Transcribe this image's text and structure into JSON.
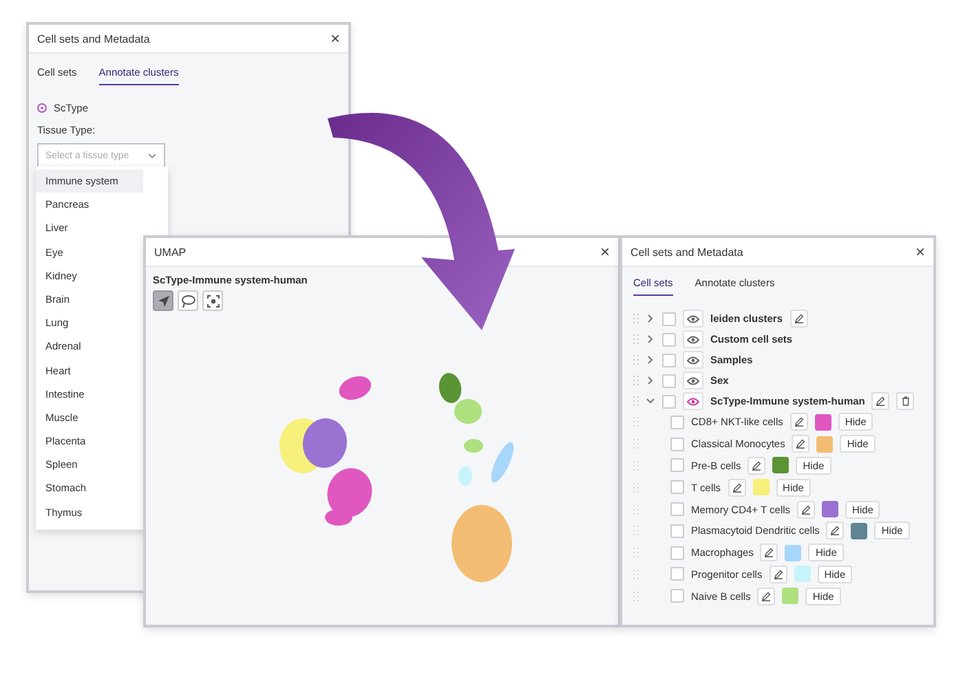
{
  "annotate_window": {
    "title": "Cell sets and Metadata",
    "close": "×",
    "tabs": [
      {
        "label": "Cell sets",
        "selected": false
      },
      {
        "label": "Annotate clusters",
        "selected": true
      }
    ],
    "method": {
      "label": "ScType",
      "selected": true
    },
    "tissue_label": "Tissue Type:",
    "tissue_select": {
      "placeholder": "Select a tissue type"
    },
    "tissue_options": [
      {
        "label": "Immune system",
        "selected": true
      },
      {
        "label": "Pancreas",
        "selected": false
      },
      {
        "label": "Liver",
        "selected": false
      },
      {
        "label": "Eye",
        "selected": false
      },
      {
        "label": "Kidney",
        "selected": false
      },
      {
        "label": "Brain",
        "selected": false
      },
      {
        "label": "Lung",
        "selected": false
      },
      {
        "label": "Adrenal",
        "selected": false
      },
      {
        "label": "Heart",
        "selected": false
      },
      {
        "label": "Intestine",
        "selected": false
      },
      {
        "label": "Muscle",
        "selected": false
      },
      {
        "label": "Placenta",
        "selected": false
      },
      {
        "label": "Spleen",
        "selected": false
      },
      {
        "label": "Stomach",
        "selected": false
      },
      {
        "label": "Thymus",
        "selected": false
      }
    ]
  },
  "umap_window": {
    "title": "UMAP",
    "close": "×",
    "plot_title": "ScType-Immune system-human",
    "tools": [
      {
        "kind": "select",
        "selected": true
      },
      {
        "kind": "lasso",
        "selected": false
      },
      {
        "kind": "focus",
        "selected": false
      }
    ]
  },
  "cell_sets_window": {
    "title": "Cell sets and Metadata",
    "close": "×",
    "tabs": [
      {
        "label": "Cell sets",
        "selected": true
      },
      {
        "label": "Annotate clusters",
        "selected": false
      }
    ],
    "groups": [
      {
        "name": "leiden clusters",
        "expanded": false,
        "checked": false,
        "highlighted": false,
        "editable": true,
        "deletable": false
      },
      {
        "name": "Custom cell sets",
        "expanded": false,
        "checked": false,
        "highlighted": false,
        "editable": false,
        "deletable": false
      },
      {
        "name": "Samples",
        "expanded": false,
        "checked": false,
        "highlighted": false,
        "editable": false,
        "deletable": false
      },
      {
        "name": "Sex",
        "expanded": false,
        "checked": false,
        "highlighted": false,
        "editable": false,
        "deletable": false
      },
      {
        "name": "ScType-Immune system-human",
        "expanded": true,
        "checked": false,
        "highlighted": true,
        "editable": true,
        "deletable": true,
        "children": [
          {
            "name": "CD8+ NKT-like cells",
            "checked": false,
            "color": "#e057c0",
            "button": "Hide"
          },
          {
            "name": "Classical Monocytes",
            "checked": false,
            "color": "#f2bd72",
            "button": "Hide"
          },
          {
            "name": "Pre-B cells",
            "checked": false,
            "color": "#5a9434",
            "button": "Hide"
          },
          {
            "name": "T cells",
            "checked": false,
            "color": "#f7f07a",
            "button": "Hide"
          },
          {
            "name": "Memory CD4+ T cells",
            "checked": false,
            "color": "#9a72d2",
            "button": "Hide"
          },
          {
            "name": "Plasmacytoid Dendritic cells",
            "checked": false,
            "color": "#5f8595",
            "button": "Hide"
          },
          {
            "name": "Macrophages",
            "checked": false,
            "color": "#a7d6fb",
            "button": "Hide"
          },
          {
            "name": "Progenitor cells",
            "checked": false,
            "color": "#c7f4fb",
            "button": "Hide"
          },
          {
            "name": "Naive B cells",
            "checked": false,
            "color": "#aee07f",
            "button": "Hide"
          }
        ]
      }
    ]
  }
}
